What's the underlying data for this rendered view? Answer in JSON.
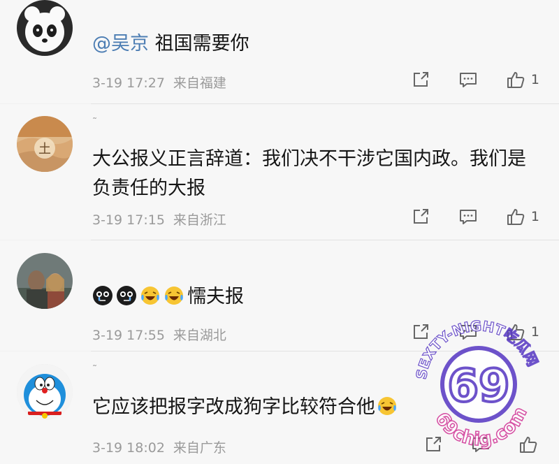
{
  "comments": [
    {
      "username": "",
      "mention": "@吴京",
      "text": "祖国需要你",
      "time": "3-19 17:27",
      "source": "来自福建",
      "likes": "1",
      "avatar": "panda-avatar"
    },
    {
      "username": "˜",
      "mention": "",
      "text": "大公报义正言辞道：我们决不干涉它国内政。我们是负责任的大报",
      "time": "3-19 17:15",
      "source": "来自浙江",
      "likes": "1",
      "avatar": "desert-avatar"
    },
    {
      "username": "",
      "mention": "",
      "text": "懦夫报",
      "emoji_prefix": [
        "crying-dark-emoji",
        "crying-dark-emoji",
        "laughing-tears-emoji",
        "laughing-tears-emoji"
      ],
      "time": "3-19 17:55",
      "source": "来自湖北",
      "likes": "1",
      "avatar": "photo-avatar"
    },
    {
      "username": "˜",
      "mention": "",
      "text": "它应该把报字改成狗字比较符合他",
      "emoji_suffix": [
        "laughing-tears-emoji"
      ],
      "time": "3-19 18:02",
      "source": "来自广东",
      "likes": "",
      "avatar": "doraemon-avatar"
    }
  ],
  "watermark": {
    "text_top": "SEXTY-NIGHT吃瓜网",
    "text_center": "69",
    "text_bottom": "69chig.com"
  },
  "colors": {
    "mention": "#4c7db3",
    "meta": "#9a9a9a",
    "background": "#f7f7f7",
    "watermark": "#5a3cc4"
  }
}
